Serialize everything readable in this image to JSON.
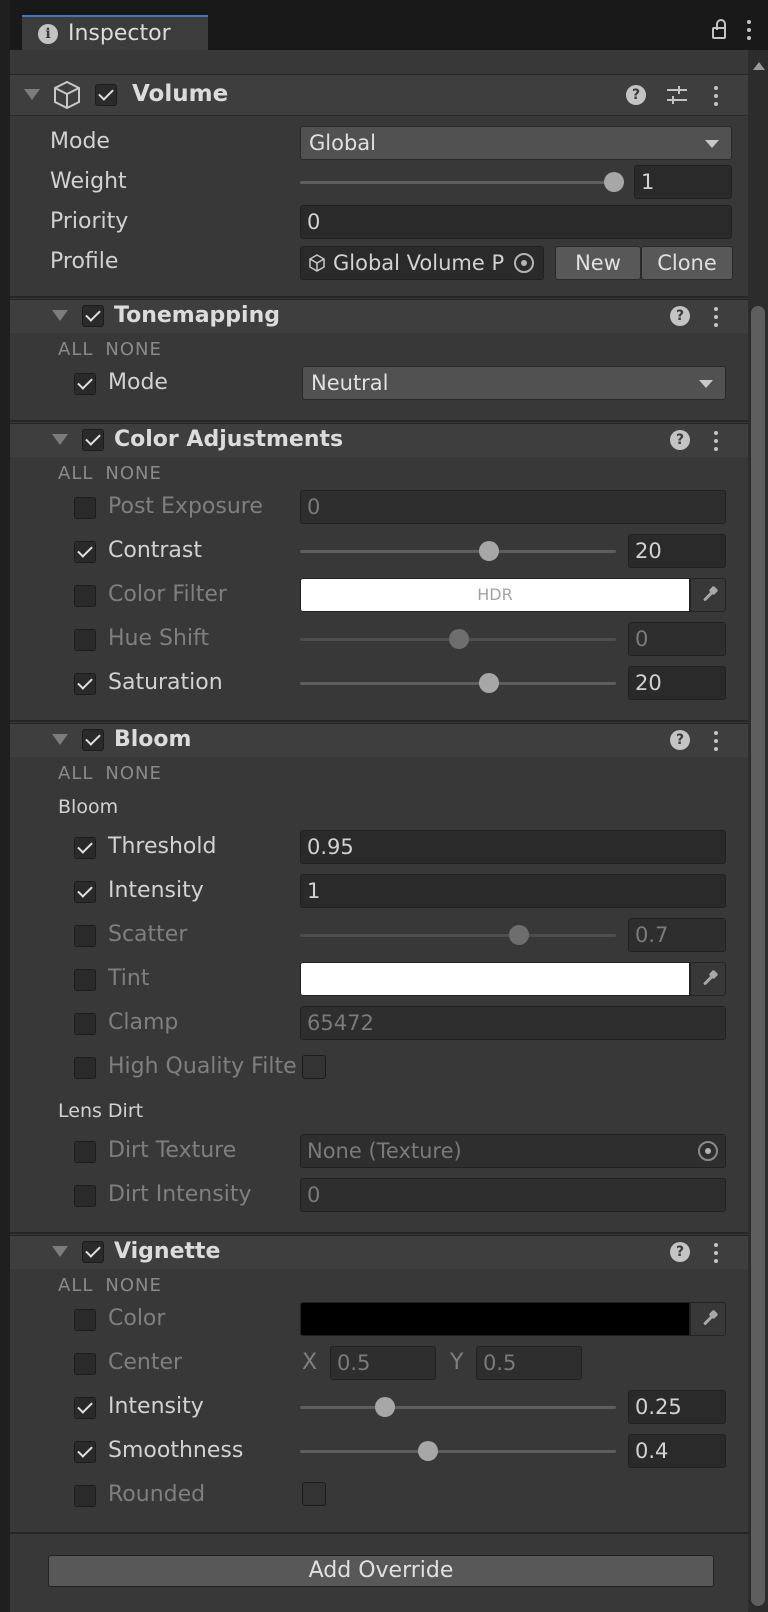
{
  "window": {
    "tab_title": "Inspector"
  },
  "component": {
    "name": "Volume",
    "enabled": true,
    "mode_label": "Mode",
    "mode_value": "Global",
    "weight_label": "Weight",
    "weight_value": "1",
    "weight_fraction": 1.0,
    "priority_label": "Priority",
    "priority_value": "0",
    "profile_label": "Profile",
    "profile_value": "Global Volume P",
    "new_label": "New",
    "clone_label": "Clone"
  },
  "all_label": "ALL",
  "none_label": "NONE",
  "tonemapping": {
    "title": "Tonemapping",
    "enabled": true,
    "mode_label": "Mode",
    "mode_value": "Neutral",
    "mode_checked": true
  },
  "color_adjustments": {
    "title": "Color Adjustments",
    "enabled": true,
    "post_exposure_label": "Post Exposure",
    "post_exposure_value": "0",
    "contrast_label": "Contrast",
    "contrast_value": "20",
    "color_filter_label": "Color Filter",
    "color_filter_text": "HDR",
    "hue_shift_label": "Hue Shift",
    "hue_shift_value": "0",
    "saturation_label": "Saturation",
    "saturation_value": "20"
  },
  "bloom": {
    "title": "Bloom",
    "enabled": true,
    "group_bloom": "Bloom",
    "threshold_label": "Threshold",
    "threshold_value": "0.95",
    "intensity_label": "Intensity",
    "intensity_value": "1",
    "scatter_label": "Scatter",
    "scatter_value": "0.7",
    "tint_label": "Tint",
    "clamp_label": "Clamp",
    "clamp_value": "65472",
    "hq_label": "High Quality Filte",
    "group_lens_dirt": "Lens Dirt",
    "dirt_texture_label": "Dirt Texture",
    "dirt_texture_value": "None (Texture)",
    "dirt_intensity_label": "Dirt Intensity",
    "dirt_intensity_value": "0"
  },
  "vignette": {
    "title": "Vignette",
    "enabled": true,
    "color_label": "Color",
    "center_label": "Center",
    "center_x_label": "X",
    "center_x_value": "0.5",
    "center_y_label": "Y",
    "center_y_value": "0.5",
    "intensity_label": "Intensity",
    "intensity_value": "0.25",
    "smoothness_label": "Smoothness",
    "smoothness_value": "0.4",
    "rounded_label": "Rounded"
  },
  "add_override_label": "Add Override",
  "colors": {
    "panel_bg": "#383838",
    "field_bg": "#2a2a2a",
    "tab_accent": "#3a79bb",
    "color_filter": "#ffffff",
    "bloom_tint": "#ffffff",
    "vignette_color": "#000000"
  }
}
